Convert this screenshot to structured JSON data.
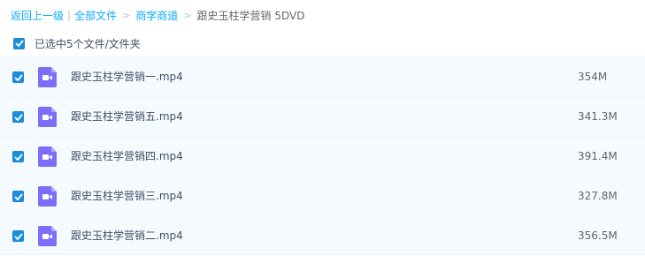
{
  "breadcrumb": {
    "back": "返回上一级",
    "all_files": "全部文件",
    "folder": "商学商道",
    "current": "跟史玉柱学营销 5DVD"
  },
  "selection": {
    "label": "已选中5个文件/文件夹"
  },
  "colors": {
    "link": "#09aaff",
    "checkbox": "#1d8ddd",
    "row_bg": "#f5fafe",
    "video_icon": "#7e6df6"
  },
  "files": [
    {
      "name": "跟史玉柱学营销一.mp4",
      "size": "354M",
      "checked": true,
      "icon": "video-file-icon"
    },
    {
      "name": "跟史玉柱学营销五.mp4",
      "size": "341.3M",
      "checked": true,
      "icon": "video-file-icon"
    },
    {
      "name": "跟史玉柱学营销四.mp4",
      "size": "391.4M",
      "checked": true,
      "icon": "video-file-icon"
    },
    {
      "name": "跟史玉柱学营销三.mp4",
      "size": "327.8M",
      "checked": true,
      "icon": "video-file-icon"
    },
    {
      "name": "跟史玉柱学营销二.mp4",
      "size": "356.5M",
      "checked": true,
      "icon": "video-file-icon"
    }
  ]
}
